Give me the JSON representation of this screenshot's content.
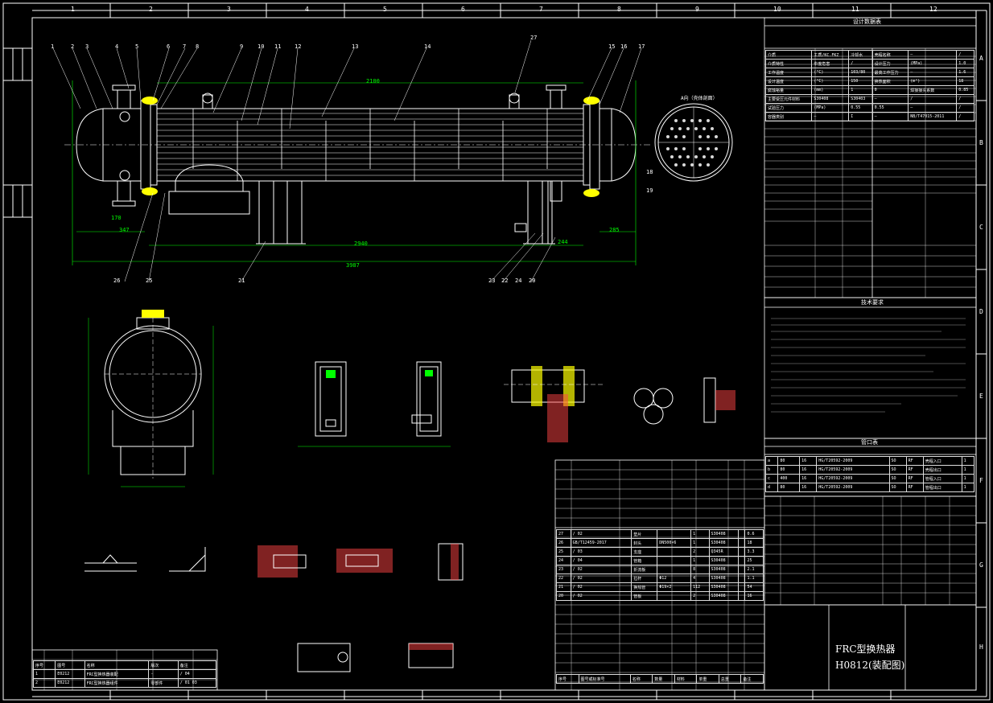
{
  "grid_top": [
    "1",
    "2",
    "3",
    "4",
    "5",
    "6",
    "7",
    "8",
    "9",
    "10",
    "11",
    "12"
  ],
  "grid_side": [
    "A",
    "B",
    "C",
    "D",
    "E",
    "F",
    "G",
    "H"
  ],
  "section_titles": {
    "design_data": "设计数据表",
    "tech_req": "技术要求",
    "nozzle_table": "管口表",
    "view_a": "A向（壳体剖面）"
  },
  "title_block": {
    "line1": "FRC型换热器",
    "line2": "H0812(装配图)"
  },
  "notes_tables": {
    "rev_header": [
      "序号",
      "图号",
      "名称",
      "版次",
      "备注"
    ],
    "rev_rows": [
      [
        "1",
        "E0212",
        "FRC型换热器装配",
        "-",
        "/ 04"
      ],
      [
        "2",
        "E0212",
        "FRC型换热器组件",
        "零部件",
        "/ 01 03"
      ]
    ]
  },
  "callouts": [
    "1",
    "2",
    "3",
    "4",
    "5",
    "6",
    "7",
    "8",
    "9",
    "10",
    "11",
    "12",
    "13",
    "14",
    "15",
    "16",
    "17",
    "18",
    "19",
    "20",
    "21",
    "22",
    "23",
    "24",
    "25",
    "26",
    "27"
  ],
  "dims": {
    "overall": "3987",
    "mid": "2940",
    "shell": "2100",
    "left_a": "347",
    "right_a": "285",
    "left_b": "170",
    "right_b": "244"
  },
  "design_rows": [
    [
      "介质",
      "工质/KC.FKZ",
      "冷却水",
      "壳程名称",
      "—",
      "/"
    ],
    [
      "介质特性",
      "中度危害",
      "/",
      "设计压力",
      "(MPa)",
      "1.0"
    ],
    [
      "工作温度",
      "(°C)",
      "103/80",
      "最高工作压力",
      "—",
      "1.6"
    ],
    [
      "设计温度",
      "(°C)",
      "150",
      "换热面积",
      "(m²)",
      "18"
    ],
    [
      "腐蚀裕量",
      "(mm)",
      "1",
      "0",
      "焊接接头系数",
      "0.85"
    ],
    [
      "主要受压元件材料",
      "S30408",
      "S30403",
      "—",
      "/",
      "/"
    ],
    [
      "试验压力",
      "(MPa)",
      "0.55",
      "0.55",
      "—",
      "/"
    ],
    [
      "容器类别",
      "—",
      "I",
      "—",
      "NB/T47015-2011",
      "/"
    ]
  ],
  "nozzle_rows": [
    [
      "a",
      "80",
      "16",
      "HG/T20592-2009",
      "SO",
      "RF",
      "壳程入口",
      "1"
    ],
    [
      "b",
      "80",
      "16",
      "HG/T20592-2009",
      "SO",
      "RF",
      "壳程出口",
      "1"
    ],
    [
      "c",
      "400",
      "16",
      "HG/T20592-2009",
      "SO",
      "RF",
      "管程入口",
      "1"
    ],
    [
      "d",
      "80",
      "16",
      "HG/T20592-2009",
      "SO",
      "RF",
      "管程出口",
      "1"
    ]
  ],
  "parts_rows": [
    [
      "27",
      "/ 02",
      "垫片",
      "",
      "1",
      "S30408",
      "",
      "0.6"
    ],
    [
      "26",
      "GB/T12459-2017",
      "封头",
      "DN500×6",
      "1",
      "S30408",
      "",
      "18"
    ],
    [
      "25",
      "/ 03",
      "支座",
      "",
      "2",
      "Q345R",
      "",
      "3.3"
    ],
    [
      "24",
      "/ 04",
      "管箱",
      "",
      "1",
      "S30408",
      "",
      "25"
    ],
    [
      "23",
      "/ 02",
      "折流板",
      "",
      "8",
      "S30408",
      "",
      "2.1"
    ],
    [
      "22",
      "/ 02",
      "拉杆",
      "Φ12",
      "4",
      "S30408",
      "",
      "1.1"
    ],
    [
      "21",
      "/ 02",
      "换热管",
      "Φ19×2",
      "112",
      "S30408",
      "",
      "54"
    ],
    [
      "20",
      "/ 02",
      "管板",
      "",
      "2",
      "S30408",
      "",
      "16"
    ]
  ],
  "header_parts": [
    "序号",
    "图号或标准号",
    "名称",
    "数量",
    "材料",
    "单重",
    "总重",
    "备注"
  ]
}
